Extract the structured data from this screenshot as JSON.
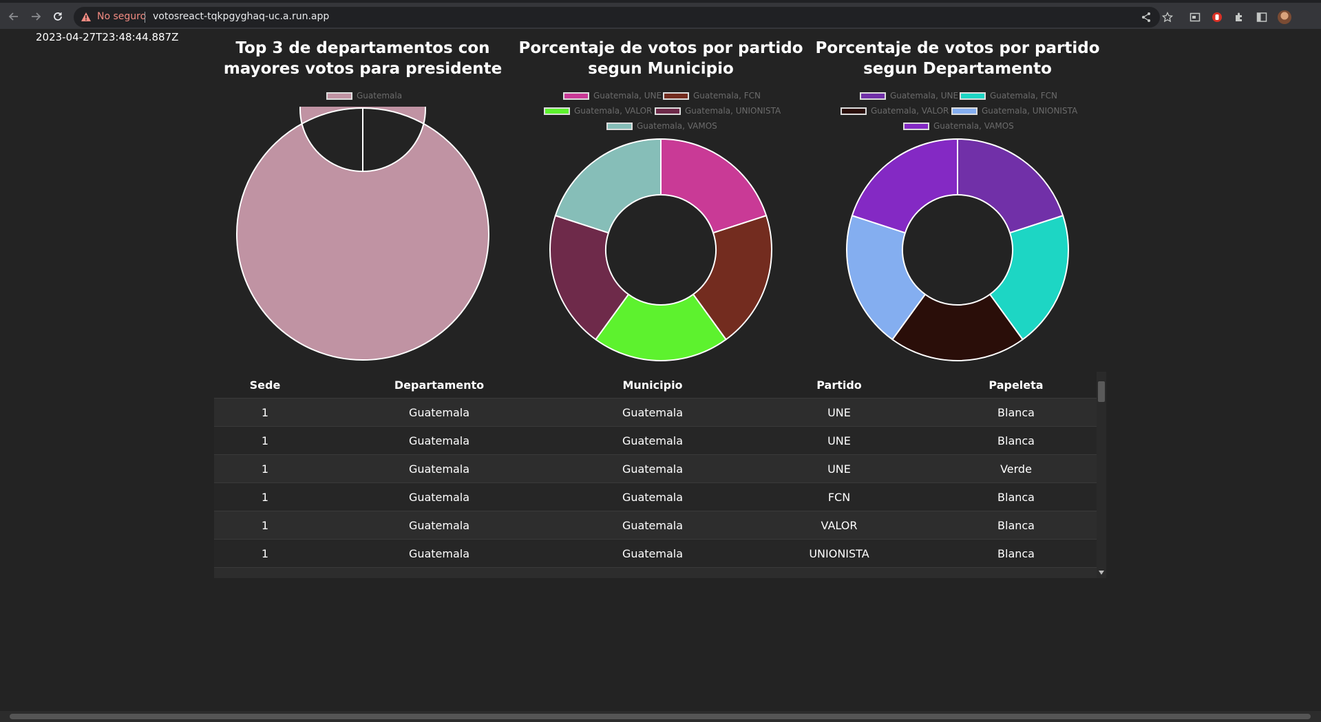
{
  "browser": {
    "not_secure_label": "No seguro",
    "url": "votosreact-tqkpgyghaq-uc.a.run.app"
  },
  "page": {
    "timestamp": "2023-04-27T23:48:44.887Z"
  },
  "charts": [
    {
      "title_line1": "Top 3 de departamentos con",
      "title_line2": "mayores votos para presidente",
      "legend": [
        "Guatemala"
      ]
    },
    {
      "title_line1": "Porcentaje de votos por partido",
      "title_line2": "segun Municipio",
      "legend": [
        "Guatemala, UNE",
        "Guatemala, FCN",
        "Guatemala, VALOR",
        "Guatemala, UNIONISTA",
        "Guatemala, VAMOS"
      ]
    },
    {
      "title_line1": "Porcentaje de votos por partido",
      "title_line2": "segun Departamento",
      "legend": [
        "Guatemala, UNE",
        "Guatemala, FCN",
        "Guatemala, VALOR",
        "Guatemala, UNIONISTA",
        "Guatemala, VAMOS"
      ]
    }
  ],
  "chart_data": [
    {
      "type": "pie",
      "title": "Top 3 de departamentos con mayores votos para presidente",
      "labels": [
        "Guatemala"
      ],
      "values": [
        1
      ],
      "colors": [
        "#c093a3"
      ]
    },
    {
      "type": "pie",
      "title": "Porcentaje de votos por partido segun Municipio",
      "labels": [
        "Guatemala, UNE",
        "Guatemala, FCN",
        "Guatemala, VALOR",
        "Guatemala, UNIONISTA",
        "Guatemala, VAMOS"
      ],
      "values": [
        1,
        1,
        1,
        1,
        1
      ],
      "colors": [
        "#c93a96",
        "#732c1f",
        "#5df22e",
        "#6e2a4a",
        "#86beb8"
      ]
    },
    {
      "type": "pie",
      "title": "Porcentaje de votos por partido segun Departamento",
      "labels": [
        "Guatemala, UNE",
        "Guatemala, FCN",
        "Guatemala, VALOR",
        "Guatemala, UNIONISTA",
        "Guatemala, VAMOS"
      ],
      "values": [
        1,
        1,
        1,
        1,
        1
      ],
      "colors": [
        "#7130a8",
        "#1dd6c4",
        "#2a0e09",
        "#84aef0",
        "#8429c4"
      ]
    }
  ],
  "table": {
    "headers": [
      "Sede",
      "Departamento",
      "Municipio",
      "Partido",
      "Papeleta"
    ],
    "rows": [
      [
        "1",
        "Guatemala",
        "Guatemala",
        "UNE",
        "Blanca"
      ],
      [
        "1",
        "Guatemala",
        "Guatemala",
        "UNE",
        "Blanca"
      ],
      [
        "1",
        "Guatemala",
        "Guatemala",
        "UNE",
        "Verde"
      ],
      [
        "1",
        "Guatemala",
        "Guatemala",
        "FCN",
        "Blanca"
      ],
      [
        "1",
        "Guatemala",
        "Guatemala",
        "VALOR",
        "Blanca"
      ],
      [
        "1",
        "Guatemala",
        "Guatemala",
        "UNIONISTA",
        "Blanca"
      ]
    ]
  }
}
